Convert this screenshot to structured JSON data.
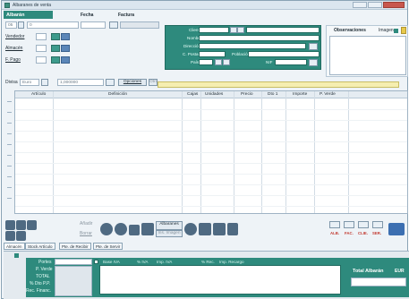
{
  "window": {
    "title": "Albaranes de venta"
  },
  "header": {
    "section_title": "Albarán",
    "col_fecha": "Fecha",
    "col_factura": "Factura",
    "serie_value": "05",
    "number_value": "0",
    "fields": {
      "vendedor": "Vendedor",
      "almacen": "Almacén",
      "pago": "F. Pago"
    },
    "divisa_label": "Divisa",
    "divisa_value": "Euro",
    "cambio_value": "1,000000",
    "opciones_label": "Opciones",
    "otro_label": "Otro"
  },
  "client_box": {
    "labels": [
      "Cliente",
      "Nombre",
      "Dirección",
      "C. Postal",
      "País"
    ],
    "nif_label": "NIF",
    "poblacion_label": "Población"
  },
  "observaciones": {
    "label": "Observaciones",
    "imagen_label": "Imagen"
  },
  "grid": {
    "columns": [
      "Artículo",
      "Definición",
      "Cajas",
      "Unidades",
      "Precio",
      "Dto 1",
      "Importe",
      "P. Verde"
    ]
  },
  "bottom_tools": {
    "small_labels": [
      "Añadir",
      "Borrar",
      "Albaranes",
      "Ins. Imagen"
    ]
  },
  "nav": {
    "labels": [
      "ALB.",
      "FAC.",
      "CLIE.",
      "SER."
    ]
  },
  "tabs": [
    "Almacén",
    "Stock Artículo",
    "Pte. de Recibir",
    "Pte. de Servir"
  ],
  "footer": {
    "left_labels": [
      "Portes",
      "P. Verde",
      "TOTAL",
      "% Dto P.P.",
      "Rec. Financ."
    ],
    "columns": [
      "Base IVA",
      "% IVA",
      "Imp. IVA",
      "% Rec.",
      "Imp. Recargo"
    ],
    "total_label": "Total Albarán",
    "total_suffix": "EUR"
  },
  "colors": {
    "accent": "#2e8a7d",
    "grid_border": "#9fb3c4",
    "highlight": "#f5eeb0"
  }
}
